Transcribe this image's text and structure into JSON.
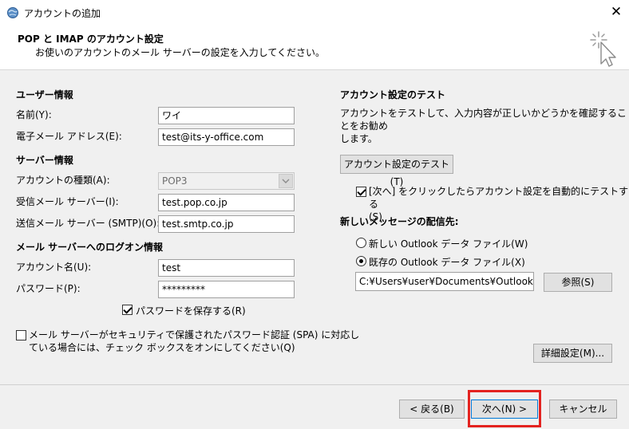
{
  "window": {
    "title": "アカウントの追加",
    "close_label": "✕"
  },
  "header": {
    "title": "POP と IMAP のアカウント設定",
    "subtitle": "お使いのアカウントのメール サーバーの設定を入力してください。"
  },
  "user_info": {
    "section": "ユーザー情報",
    "name_label": "名前(Y):",
    "name_value": "ワイ",
    "email_label": "電子メール アドレス(E):",
    "email_value": "test@its-y-office.com"
  },
  "server_info": {
    "section": "サーバー情報",
    "account_type_label": "アカウントの種類(A):",
    "account_type_value": "POP3",
    "incoming_label": "受信メール サーバー(I):",
    "incoming_value": "test.pop.co.jp",
    "outgoing_label": "送信メール サーバー (SMTP)(O):",
    "outgoing_value": "test.smtp.co.jp"
  },
  "logon_info": {
    "section": "メール サーバーへのログオン情報",
    "account_name_label": "アカウント名(U):",
    "account_name_value": "test",
    "password_label": "パスワード(P):",
    "password_value": "*********",
    "save_password_label": "パスワードを保存する(R)",
    "save_password_checked": true,
    "spa_label_line1": "メール サーバーがセキュリティで保護されたパスワード認証 (SPA) に対応し",
    "spa_label_line2": "ている場合には、チェック ボックスをオンにしてください(Q)",
    "spa_checked": false
  },
  "test_settings": {
    "section": "アカウント設定のテスト",
    "desc_line1": "アカウントをテストして、入力内容が正しいかどうかを確認することをお勧め",
    "desc_line2": "します。",
    "test_button": "アカウント設定のテスト(T)",
    "auto_test_line1": "[次へ] をクリックしたらアカウント設定を自動的にテストする",
    "auto_test_line2": "(S)",
    "auto_test_checked": true
  },
  "delivery": {
    "section": "新しいメッセージの配信先:",
    "new_file_label": "新しい Outlook データ ファイル(W)",
    "existing_file_label": "既存の Outlook データ ファイル(X)",
    "selected": "existing",
    "path_value": "C:¥Users¥user¥Documents¥Outlook ファ",
    "browse_button": "参照(S)"
  },
  "advanced_button": "詳細設定(M)...",
  "footer": {
    "back": "< 戻る(B)",
    "next": "次へ(N) >",
    "cancel": "キャンセル"
  },
  "colors": {
    "highlight": "#e32320",
    "background": "#f0f0f0"
  }
}
